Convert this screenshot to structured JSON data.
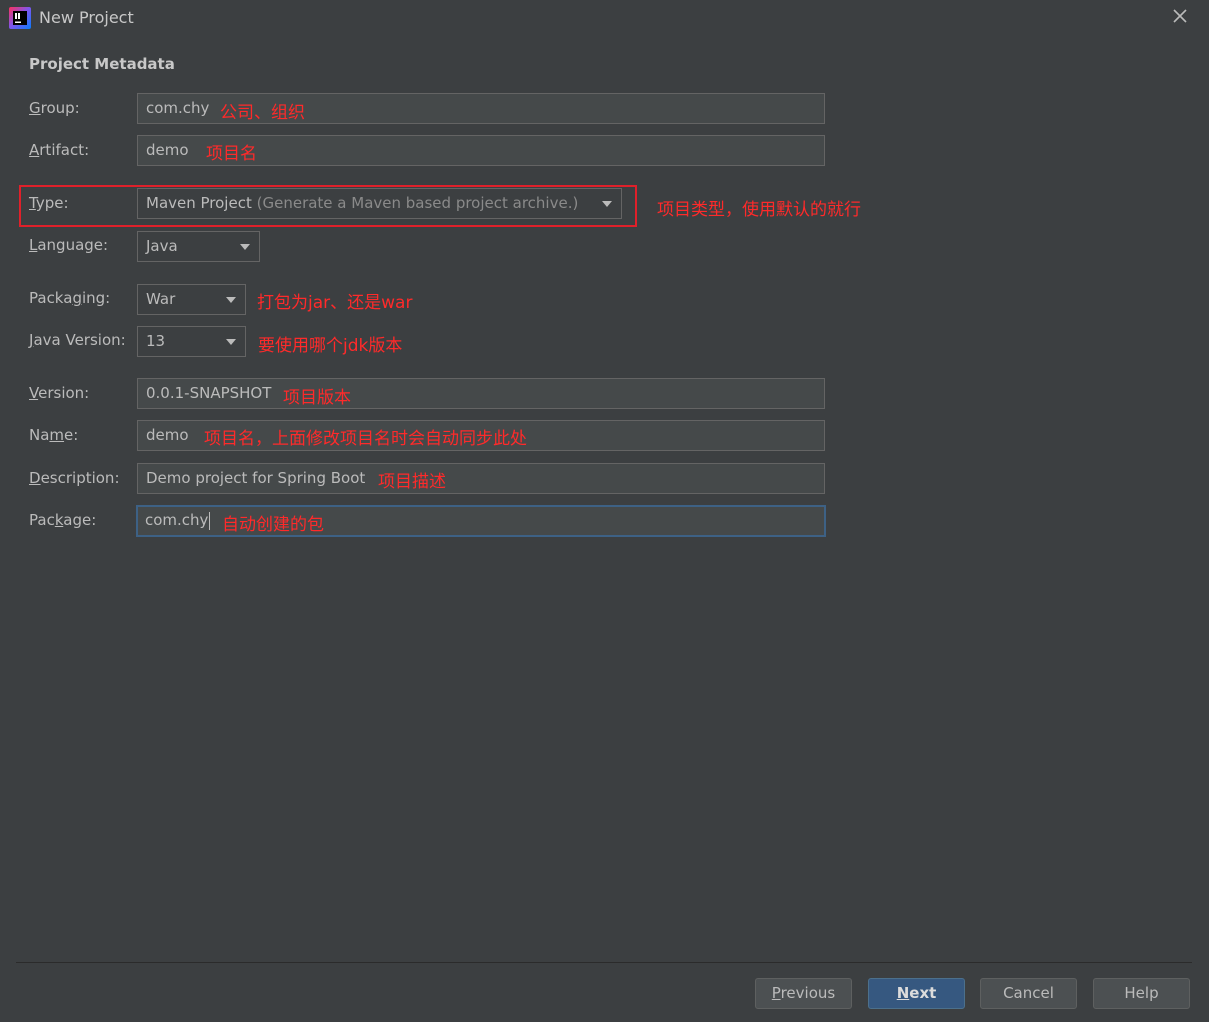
{
  "window": {
    "title": "New Project"
  },
  "section_title": "Project Metadata",
  "fields": {
    "group": {
      "label_mnemonic": "G",
      "label_rest": "roup:",
      "value": "com.chy",
      "note": "公司、组织"
    },
    "artifact": {
      "label_mnemonic": "A",
      "label_rest": "rtifact:",
      "value": "demo",
      "note": "项目名"
    },
    "type": {
      "label_mnemonic": "T",
      "label_rest": "ype:",
      "value": "Maven Project",
      "hint": "(Generate a Maven based project archive.)",
      "note": "项目类型，使用默认的就行"
    },
    "language": {
      "label_mnemonic": "L",
      "label_rest": "anguage:",
      "value": "Java"
    },
    "packaging": {
      "label_before": "Packa",
      "label_mnemonic": "g",
      "label_rest": "ing:",
      "value": "War",
      "note": "打包为jar、还是war"
    },
    "java_version": {
      "label_mnemonic": "J",
      "label_rest": "ava Version:",
      "value": "13",
      "note": "要使用哪个jdk版本"
    },
    "version": {
      "label_mnemonic": "V",
      "label_rest": "ersion:",
      "value": "0.0.1-SNAPSHOT",
      "note": "项目版本"
    },
    "name": {
      "label_before": "Na",
      "label_mnemonic": "m",
      "label_rest": "e:",
      "value": "demo",
      "note": "项目名，上面修改项目名时会自动同步此处"
    },
    "description": {
      "label_mnemonic": "D",
      "label_rest": "escription:",
      "value": "Demo project for Spring Boot",
      "note": "项目描述"
    },
    "package": {
      "label_before": "Pac",
      "label_mnemonic": "k",
      "label_rest": "age:",
      "value": "com.chy",
      "note": "自动创建的包"
    }
  },
  "buttons": {
    "previous": {
      "mnemonic": "P",
      "rest": "revious"
    },
    "next": {
      "mnemonic": "N",
      "rest": "ext"
    },
    "cancel": "Cancel",
    "help": "Help"
  },
  "colors": {
    "background": "#3c3f41",
    "annotation": "#ff2a2a",
    "focus": "#3d6185",
    "primary_button": "#365880"
  },
  "icons": {
    "app": "intellij-idea-icon",
    "close": "close-icon",
    "dropdown": "chevron-down-icon"
  }
}
